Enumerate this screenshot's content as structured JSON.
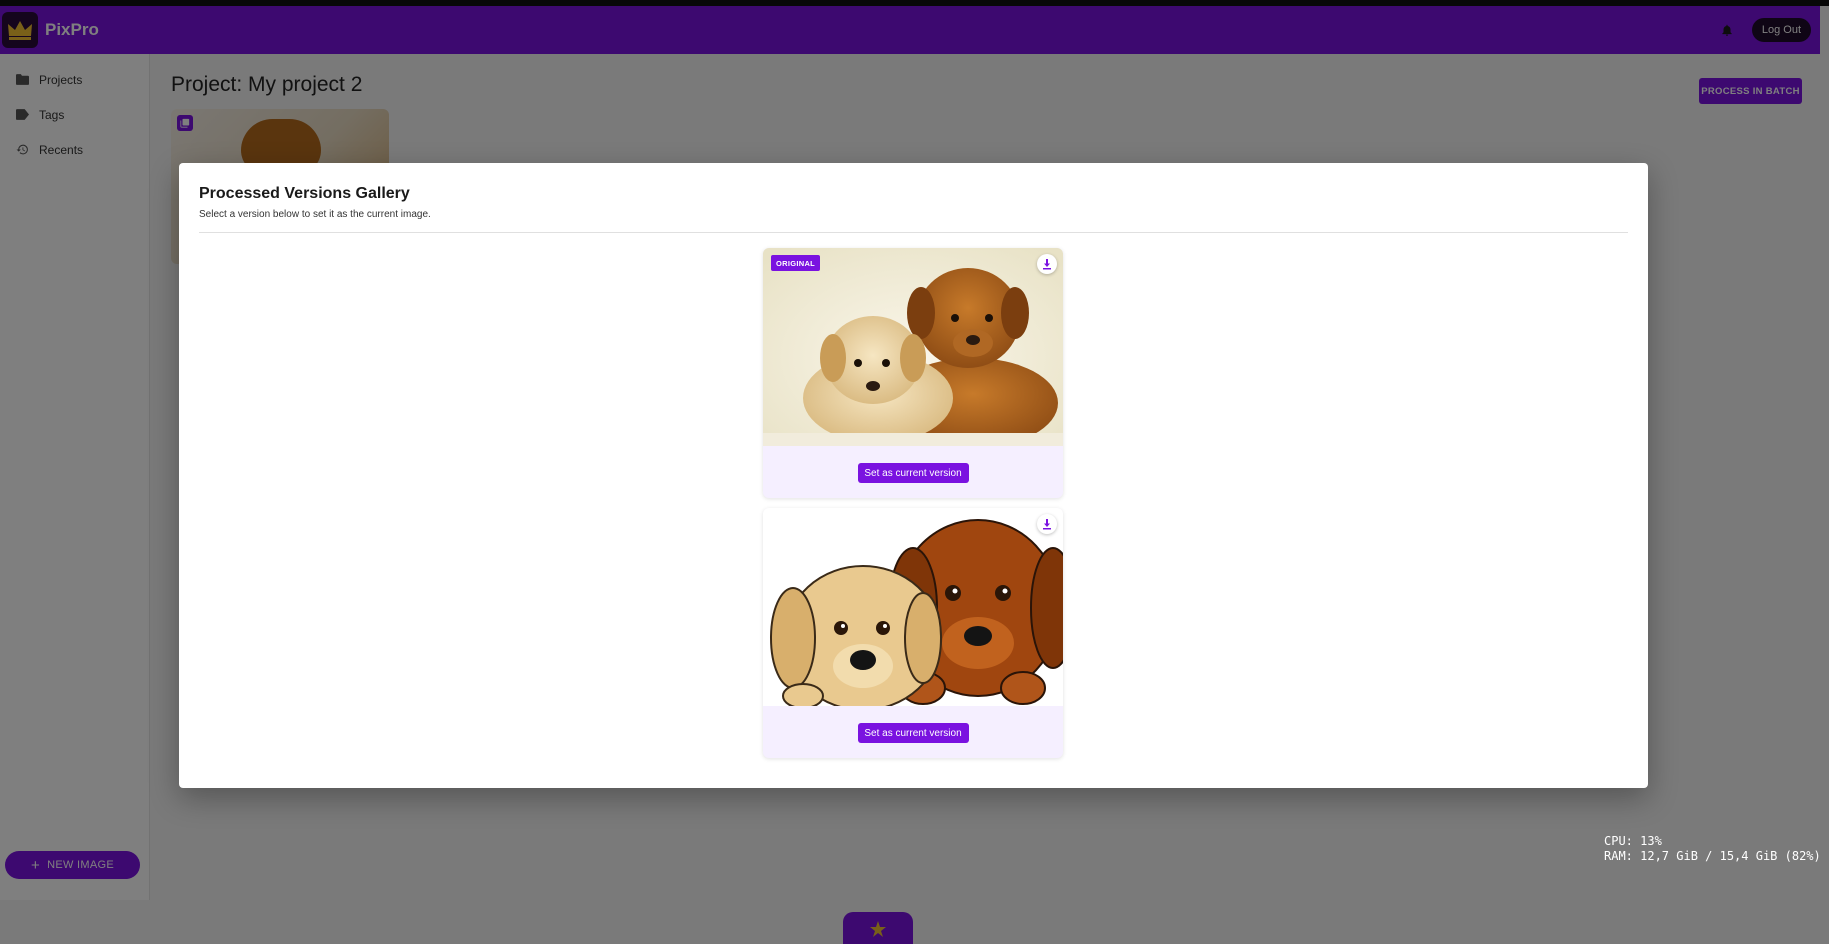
{
  "app": {
    "name": "PixPro",
    "logout_label": "Log Out"
  },
  "sidebar": {
    "items": [
      {
        "label": "Projects",
        "icon": "folder-icon"
      },
      {
        "label": "Tags",
        "icon": "tag-icon"
      },
      {
        "label": "Recents",
        "icon": "history-icon"
      }
    ],
    "new_image_label": "NEW IMAGE"
  },
  "main": {
    "title": "Project: My project 2",
    "batch_label": "PROCESS IN BATCH"
  },
  "modal": {
    "title": "Processed Versions Gallery",
    "subtitle": "Select a version below to set it as the current image.",
    "versions": [
      {
        "badge": "ORIGINAL",
        "set_label": "Set as current version",
        "image": "photo of two puppies (original)"
      },
      {
        "badge": "",
        "set_label": "Set as current version",
        "image": "illustrated two puppies (processed)"
      }
    ]
  },
  "sysinfo": {
    "cpu": "CPU: 13%",
    "ram": "RAM: 12,7 GiB / 15,4 GiB (82%)"
  },
  "colors": {
    "accent": "#7a12e0",
    "appbar": "#7a12e0",
    "overlay": "rgba(0,0,0,0.5)"
  }
}
